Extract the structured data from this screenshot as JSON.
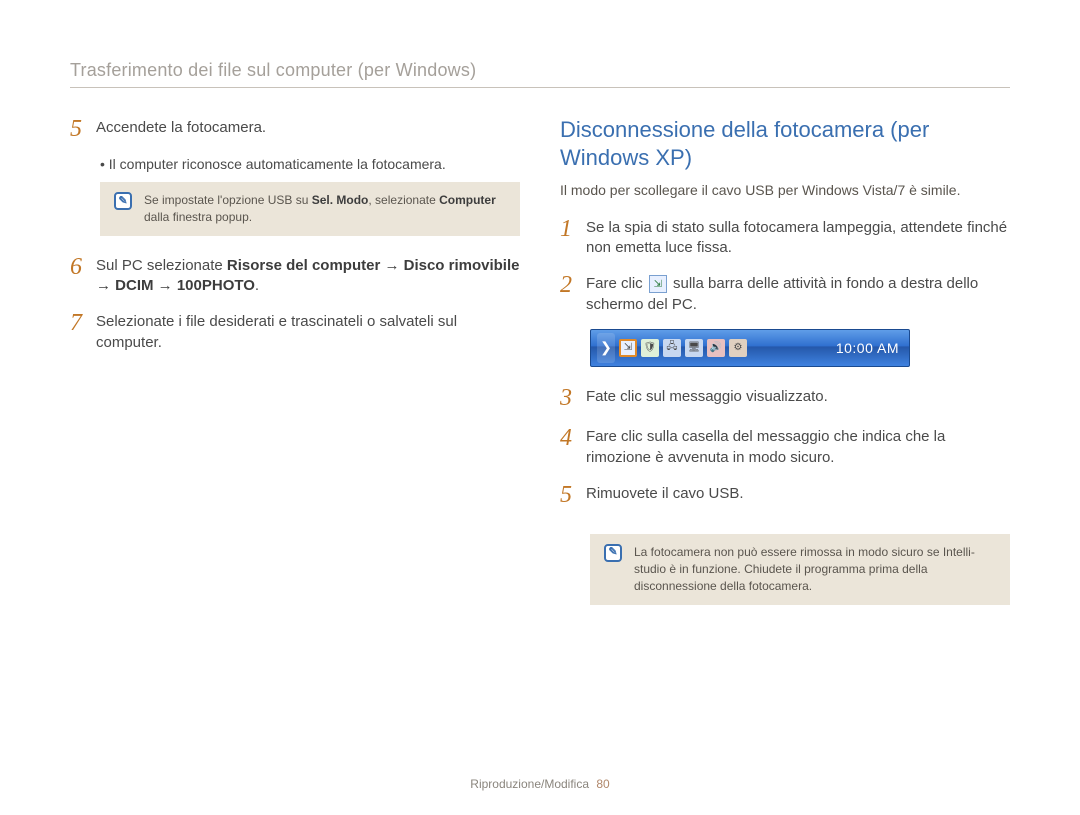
{
  "header": "Trasferimento dei file sul computer (per Windows)",
  "left": {
    "step5": {
      "num": "5",
      "text": "Accendete la fotocamera."
    },
    "bullet5": "Il computer riconosce automaticamente la fotocamera.",
    "note1": "Se impostate l'opzione USB su ",
    "note1_b1": "Sel. Modo",
    "note1_mid": ", selezionate ",
    "note1_b2": "Computer",
    "note1_end": " dalla finestra popup.",
    "step6": {
      "num": "6",
      "pre": "Sul PC selezionate ",
      "bold": "Risorse del computer → Disco rimovibile → DCIM → 100PHOTO",
      "post": "."
    },
    "step7": {
      "num": "7",
      "text": "Selezionate i file desiderati e trascinateli o salvateli sul computer."
    }
  },
  "right": {
    "title": "Disconnessione della fotocamera (per Windows XP)",
    "subtitle": "Il modo per scollegare il cavo USB per Windows Vista/7 è simile.",
    "step1": {
      "num": "1",
      "text": "Se la spia di stato sulla fotocamera lampeggia, attendete finché non emetta luce fissa."
    },
    "step2": {
      "num": "2",
      "pre": "Fare clic ",
      "post": " sulla barra delle attività in fondo a destra dello schermo del PC."
    },
    "clock": "10:00 AM",
    "step3": {
      "num": "3",
      "text": "Fate clic sul messaggio visualizzato."
    },
    "step4": {
      "num": "4",
      "text": "Fare clic sulla casella del messaggio che indica che la rimozione è avvenuta in modo sicuro."
    },
    "step5": {
      "num": "5",
      "text": "Rimuovete il cavo USB."
    },
    "note2": "La fotocamera non può essere rimossa in modo sicuro se Intelli-studio è in funzione. Chiudete il programma prima della disconnessione della fotocamera."
  },
  "footer": {
    "section": "Riproduzione/Modifica",
    "page": "80"
  }
}
